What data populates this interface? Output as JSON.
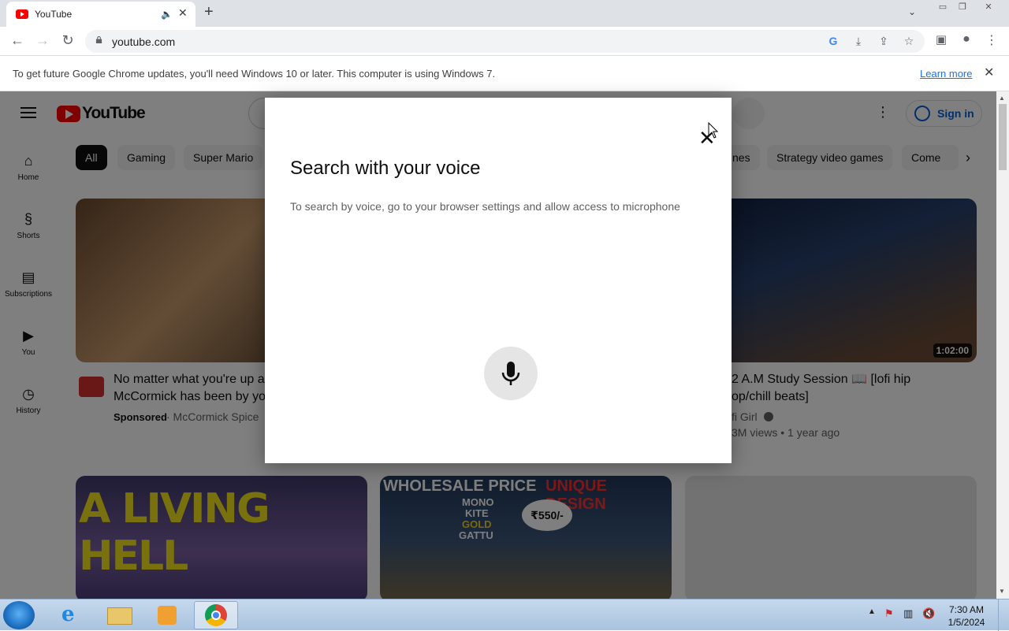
{
  "browser": {
    "tab_title": "YouTube",
    "url": "youtube.com",
    "infobar_message": "To get future Google Chrome updates, you'll need Windows 10 or later. This computer is using Windows 7.",
    "infobar_link": "Learn more"
  },
  "youtube": {
    "logo_text": "YouTube",
    "signin_label": "Sign in",
    "sidebar": [
      {
        "label": "Home",
        "icon": "home-icon"
      },
      {
        "label": "Shorts",
        "icon": "shorts-icon"
      },
      {
        "label": "Subscriptions",
        "icon": "subscriptions-icon"
      },
      {
        "label": "You",
        "icon": "you-icon"
      },
      {
        "label": "History",
        "icon": "history-icon"
      }
    ],
    "chips": [
      "All",
      "Gaming",
      "Super Mario",
      "nes",
      "Strategy video games",
      "Come"
    ],
    "videos": [
      {
        "title_line1": "No matter what you're up a",
        "title_line2": "McCormick has been by yo",
        "badge": "Sponsored",
        "channel": "· McCormick Spice"
      },
      {
        "title_line1": "2 A.M Study Session 📖 [lofi hip",
        "title_line2": "op/chill beats]",
        "channel": "fi Girl",
        "meta": "3M views • 1 year ago",
        "duration": "1:02:00"
      }
    ],
    "thumb_texts": {
      "living_hell": "A LIVING HELL",
      "wholesale": "WHOLESALE PRICE",
      "unique": "UNIQUE DESIGN",
      "mono": "MONO",
      "kite": "KITE",
      "gold": "GOLD",
      "gattu": "GATTU",
      "price": "₹550/-"
    }
  },
  "dialog": {
    "title": "Search with your voice",
    "message": "To search by voice, go to your browser settings and allow access to microphone"
  },
  "taskbar": {
    "time": "7:30 AM",
    "date": "1/5/2024"
  }
}
